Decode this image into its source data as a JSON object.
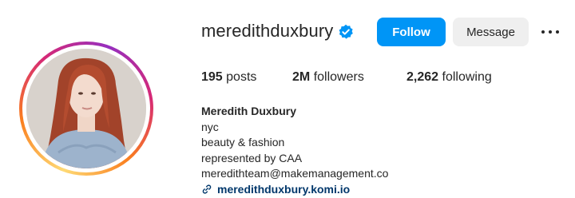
{
  "profile": {
    "username": "meredithduxbury",
    "verified": true,
    "follow_label": "Follow",
    "message_label": "Message",
    "more_icon": "more-options-icon"
  },
  "stats": {
    "posts_count": "195",
    "posts_label": "posts",
    "followers_count": "2M",
    "followers_label": "followers",
    "following_count": "2,262",
    "following_label": "following"
  },
  "bio": {
    "name": "Meredith Duxbury",
    "lines": [
      "nyc",
      "beauty & fashion",
      "represented by CAA",
      "meredithteam@makemanagement.co"
    ],
    "link": "meredithduxbury.komi.io",
    "link_icon": "link-icon"
  },
  "colors": {
    "follow_button": "#0095f6",
    "message_button": "#efefef",
    "link": "#00376b",
    "verified_badge": "#0095f6"
  }
}
